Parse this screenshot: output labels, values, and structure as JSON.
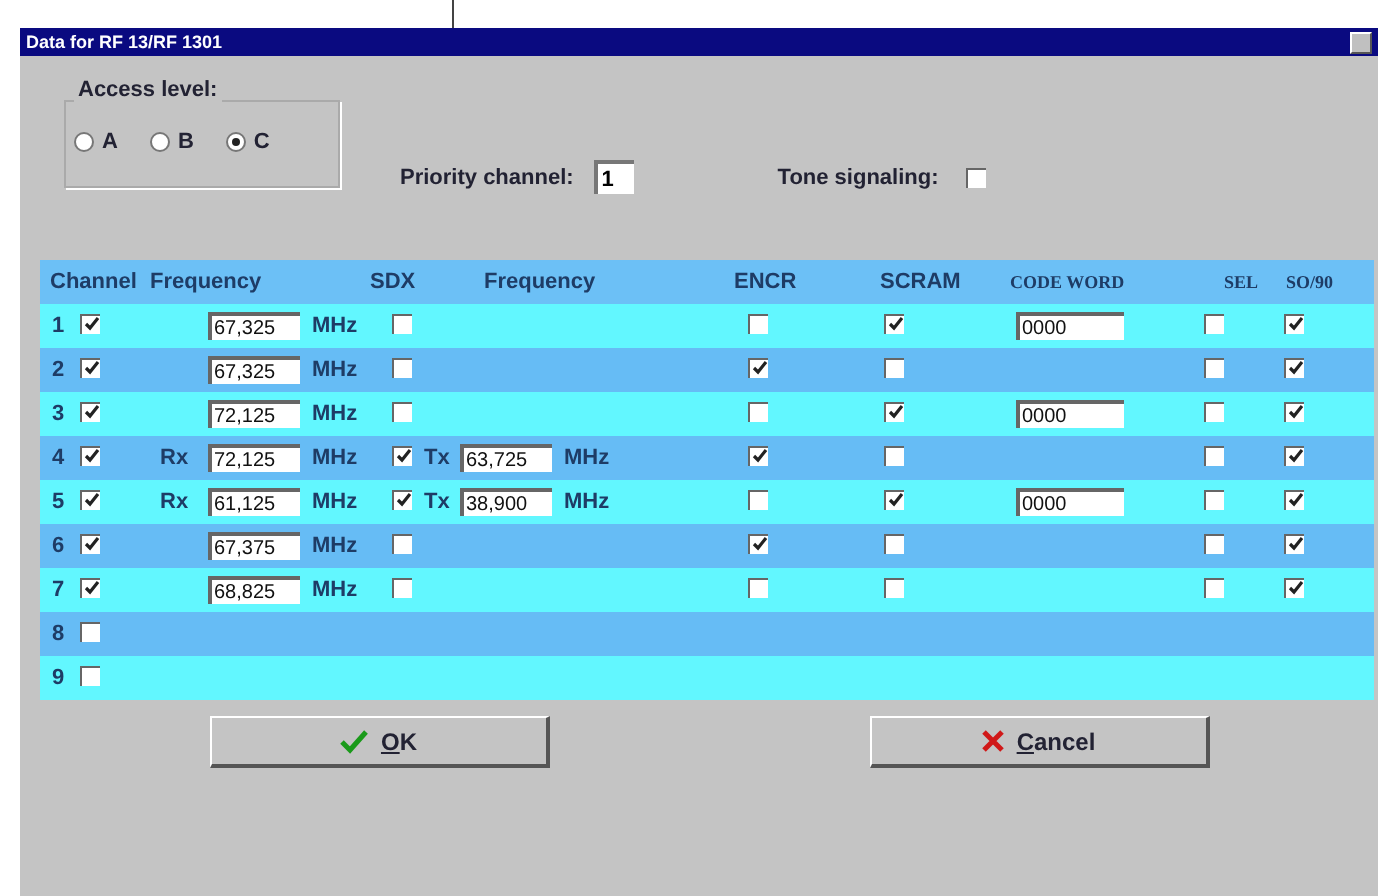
{
  "window": {
    "title": "Data for RF 13/RF 1301"
  },
  "access_level": {
    "label": "Access level:",
    "options": [
      {
        "label": "A",
        "selected": false
      },
      {
        "label": "B",
        "selected": false
      },
      {
        "label": "C",
        "selected": true
      }
    ]
  },
  "priority_channel": {
    "label": "Priority channel:",
    "value": "1"
  },
  "tone_signaling": {
    "label": "Tone signaling:",
    "checked": false
  },
  "table": {
    "columns": [
      "Channel",
      "Frequency",
      "SDX",
      "Frequency",
      "ENCR",
      "SCRAM",
      "CODE WORD",
      "SEL",
      "SO/90"
    ],
    "rows": [
      {
        "kind": "simplex",
        "number": "1",
        "enabled": true,
        "frequency": "67,325",
        "unit": "MHz",
        "sdx": false,
        "encr": false,
        "scram": true,
        "code_word": "0000",
        "sel": false,
        "so90": true
      },
      {
        "kind": "simplex",
        "number": "2",
        "enabled": true,
        "frequency": "67,325",
        "unit": "MHz",
        "sdx": false,
        "encr": true,
        "scram": false,
        "sel": false,
        "so90": true
      },
      {
        "kind": "simplex",
        "number": "3",
        "enabled": true,
        "frequency": "72,125",
        "unit": "MHz",
        "sdx": false,
        "encr": false,
        "scram": true,
        "code_word": "0000",
        "sel": false,
        "so90": true
      },
      {
        "kind": "duplex",
        "number": "4",
        "enabled": true,
        "rx_label": "Rx",
        "frequency": "72,125",
        "unit": "MHz",
        "sdx": true,
        "tx_label": "Tx",
        "tx_frequency": "63,725",
        "tx_unit": "MHz",
        "encr": true,
        "scram": false,
        "sel": false,
        "so90": true
      },
      {
        "kind": "duplex",
        "number": "5",
        "enabled": true,
        "rx_label": "Rx",
        "frequency": "61,125",
        "unit": "MHz",
        "sdx": true,
        "tx_label": "Tx",
        "tx_frequency": "38,900",
        "tx_unit": "MHz",
        "encr": false,
        "scram": true,
        "code_word": "0000",
        "sel": false,
        "so90": true
      },
      {
        "kind": "simplex",
        "number": "6",
        "enabled": true,
        "frequency": "67,375",
        "unit": "MHz",
        "sdx": false,
        "encr": true,
        "scram": false,
        "sel": false,
        "so90": true
      },
      {
        "kind": "simplex",
        "number": "7",
        "enabled": true,
        "frequency": "68,825",
        "unit": "MHz",
        "sdx": false,
        "encr": false,
        "scram": false,
        "sel": false,
        "so90": true
      },
      {
        "kind": "empty",
        "number": "8",
        "enabled": false
      },
      {
        "kind": "empty",
        "number": "9",
        "enabled": false
      }
    ]
  },
  "buttons": [
    {
      "kind": "ok",
      "label": "OK"
    },
    {
      "kind": "cancel",
      "label": "Cancel"
    }
  ]
}
